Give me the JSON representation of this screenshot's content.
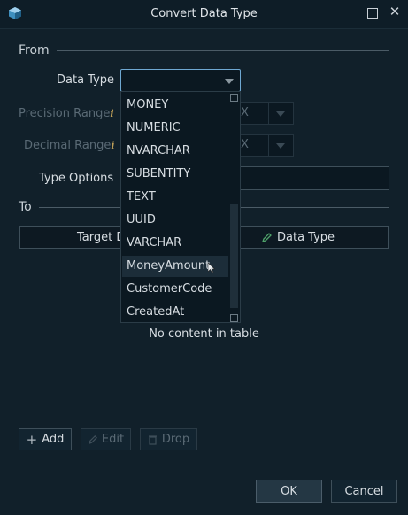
{
  "window": {
    "title": "Convert Data Type"
  },
  "from": {
    "section_label": "From",
    "data_type_label": "Data Type",
    "data_type_value": "",
    "precision_label": "Precision Range",
    "precision_value": "X",
    "decimal_label": "Decimal Range",
    "decimal_value": "X",
    "type_options_label": "Type Options",
    "info_glyph": "i"
  },
  "to": {
    "section_label": "To",
    "columns": [
      "Target D",
      "Data Type"
    ],
    "empty_text": "No content in table"
  },
  "actions": {
    "add_label": "Add",
    "edit_label": "Edit",
    "drop_label": "Drop",
    "ok_label": "OK",
    "cancel_label": "Cancel"
  },
  "dropdown": {
    "items": [
      "MONEY",
      "NUMERIC",
      "NVARCHAR",
      "SUBENTITY",
      "TEXT",
      "UUID",
      "VARCHAR",
      "MoneyAmount",
      "CustomerCode",
      "CreatedAt"
    ],
    "hovered_index": 7
  },
  "colors": {
    "focus": "#6fa8d2",
    "info": "#c0a058",
    "accent_icon": "#4fa36a"
  }
}
